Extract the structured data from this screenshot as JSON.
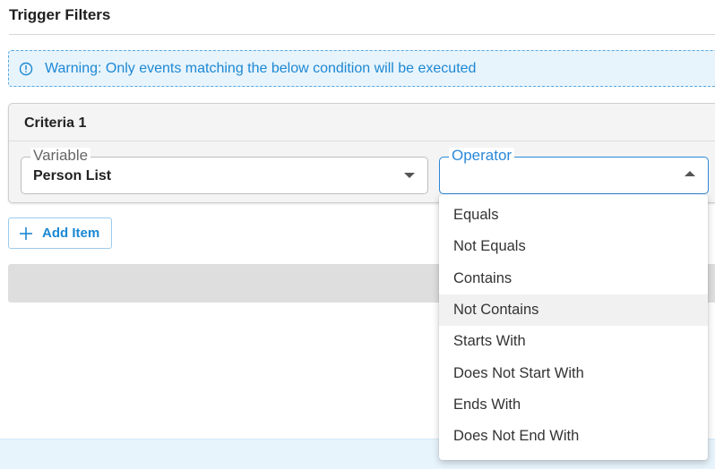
{
  "page": {
    "title": "Trigger Filters"
  },
  "warning": {
    "icon": "info-circle-icon",
    "text": "Warning: Only events matching the below condition will be executed",
    "color": "#1c88d4",
    "background": "#e8f4fc"
  },
  "criteria": {
    "title": "Criteria 1",
    "variable": {
      "label": "Variable",
      "value": "Person List",
      "icon": "chevron-down-icon"
    },
    "operator": {
      "label": "Operator",
      "value": "",
      "icon": "chevron-up-icon",
      "focused": true
    }
  },
  "actions": {
    "add_item_label": "Add Item",
    "add_item_icon": "plus-icon"
  },
  "operator_menu": {
    "items": [
      {
        "label": "Equals"
      },
      {
        "label": "Not Equals"
      },
      {
        "label": "Contains"
      },
      {
        "label": "Not Contains",
        "hovered": true
      },
      {
        "label": "Starts With"
      },
      {
        "label": "Does Not Start With"
      },
      {
        "label": "Ends With"
      },
      {
        "label": "Does Not End With"
      }
    ]
  },
  "colors": {
    "accent": "#2b88d8",
    "panel": "#f4f4f4"
  }
}
